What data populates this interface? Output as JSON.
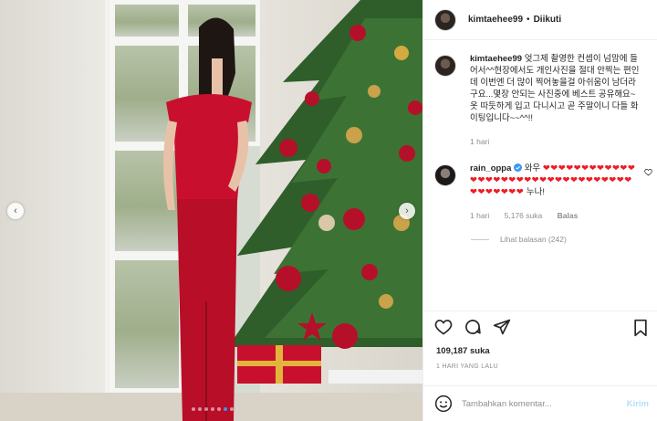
{
  "post": {
    "username": "kimtaehee99",
    "separator": "•",
    "follow_status": "Diikuti"
  },
  "caption": {
    "username": "kimtaehee99",
    "text": "엊그제 촬영한 컨셉이 넘맘에 들어서^^현장에서도 개인사진을 절대 안찍는 편인데 이번엔 더 많이 찍어놓을걸 아쉬움이 남더라구요...몇장 안되는 사진중에 베스트 공유해요~옷 따듯하게 입고 다니시고 곧 주말이니 다들 화이팅입니다~~^^!!",
    "time": "1 hari"
  },
  "comment": {
    "username": "rain_oppa",
    "verified_icon": "verified-badge-icon",
    "text_prefix": "와우",
    "hearts": "❤❤❤❤❤❤❤❤❤❤❤❤❤❤❤❤❤❤❤❤❤❤❤❤❤❤❤❤❤❤❤❤❤❤❤❤❤❤❤❤",
    "text_suffix": "누나!",
    "time": "1 hari",
    "likes": "5,176 suka",
    "reply_label": "Balas",
    "view_replies": "Lihat balasan (242)"
  },
  "stats": {
    "likes": "109,187 suka",
    "date": "1 HARI YANG LALU"
  },
  "composer": {
    "placeholder": "Tambahkan komentar...",
    "post_label": "Kirim"
  },
  "carousel": {
    "prev_icon": "‹",
    "next_icon": "›",
    "dot_count": 7,
    "active_dot": 5
  },
  "colors": {
    "accent_blue": "#3897f0",
    "post_button_disabled": "#b2dffc",
    "heart_red": "#ed1c24",
    "dress_red": "#c8102e",
    "tree_green": "#2f5e2a"
  }
}
